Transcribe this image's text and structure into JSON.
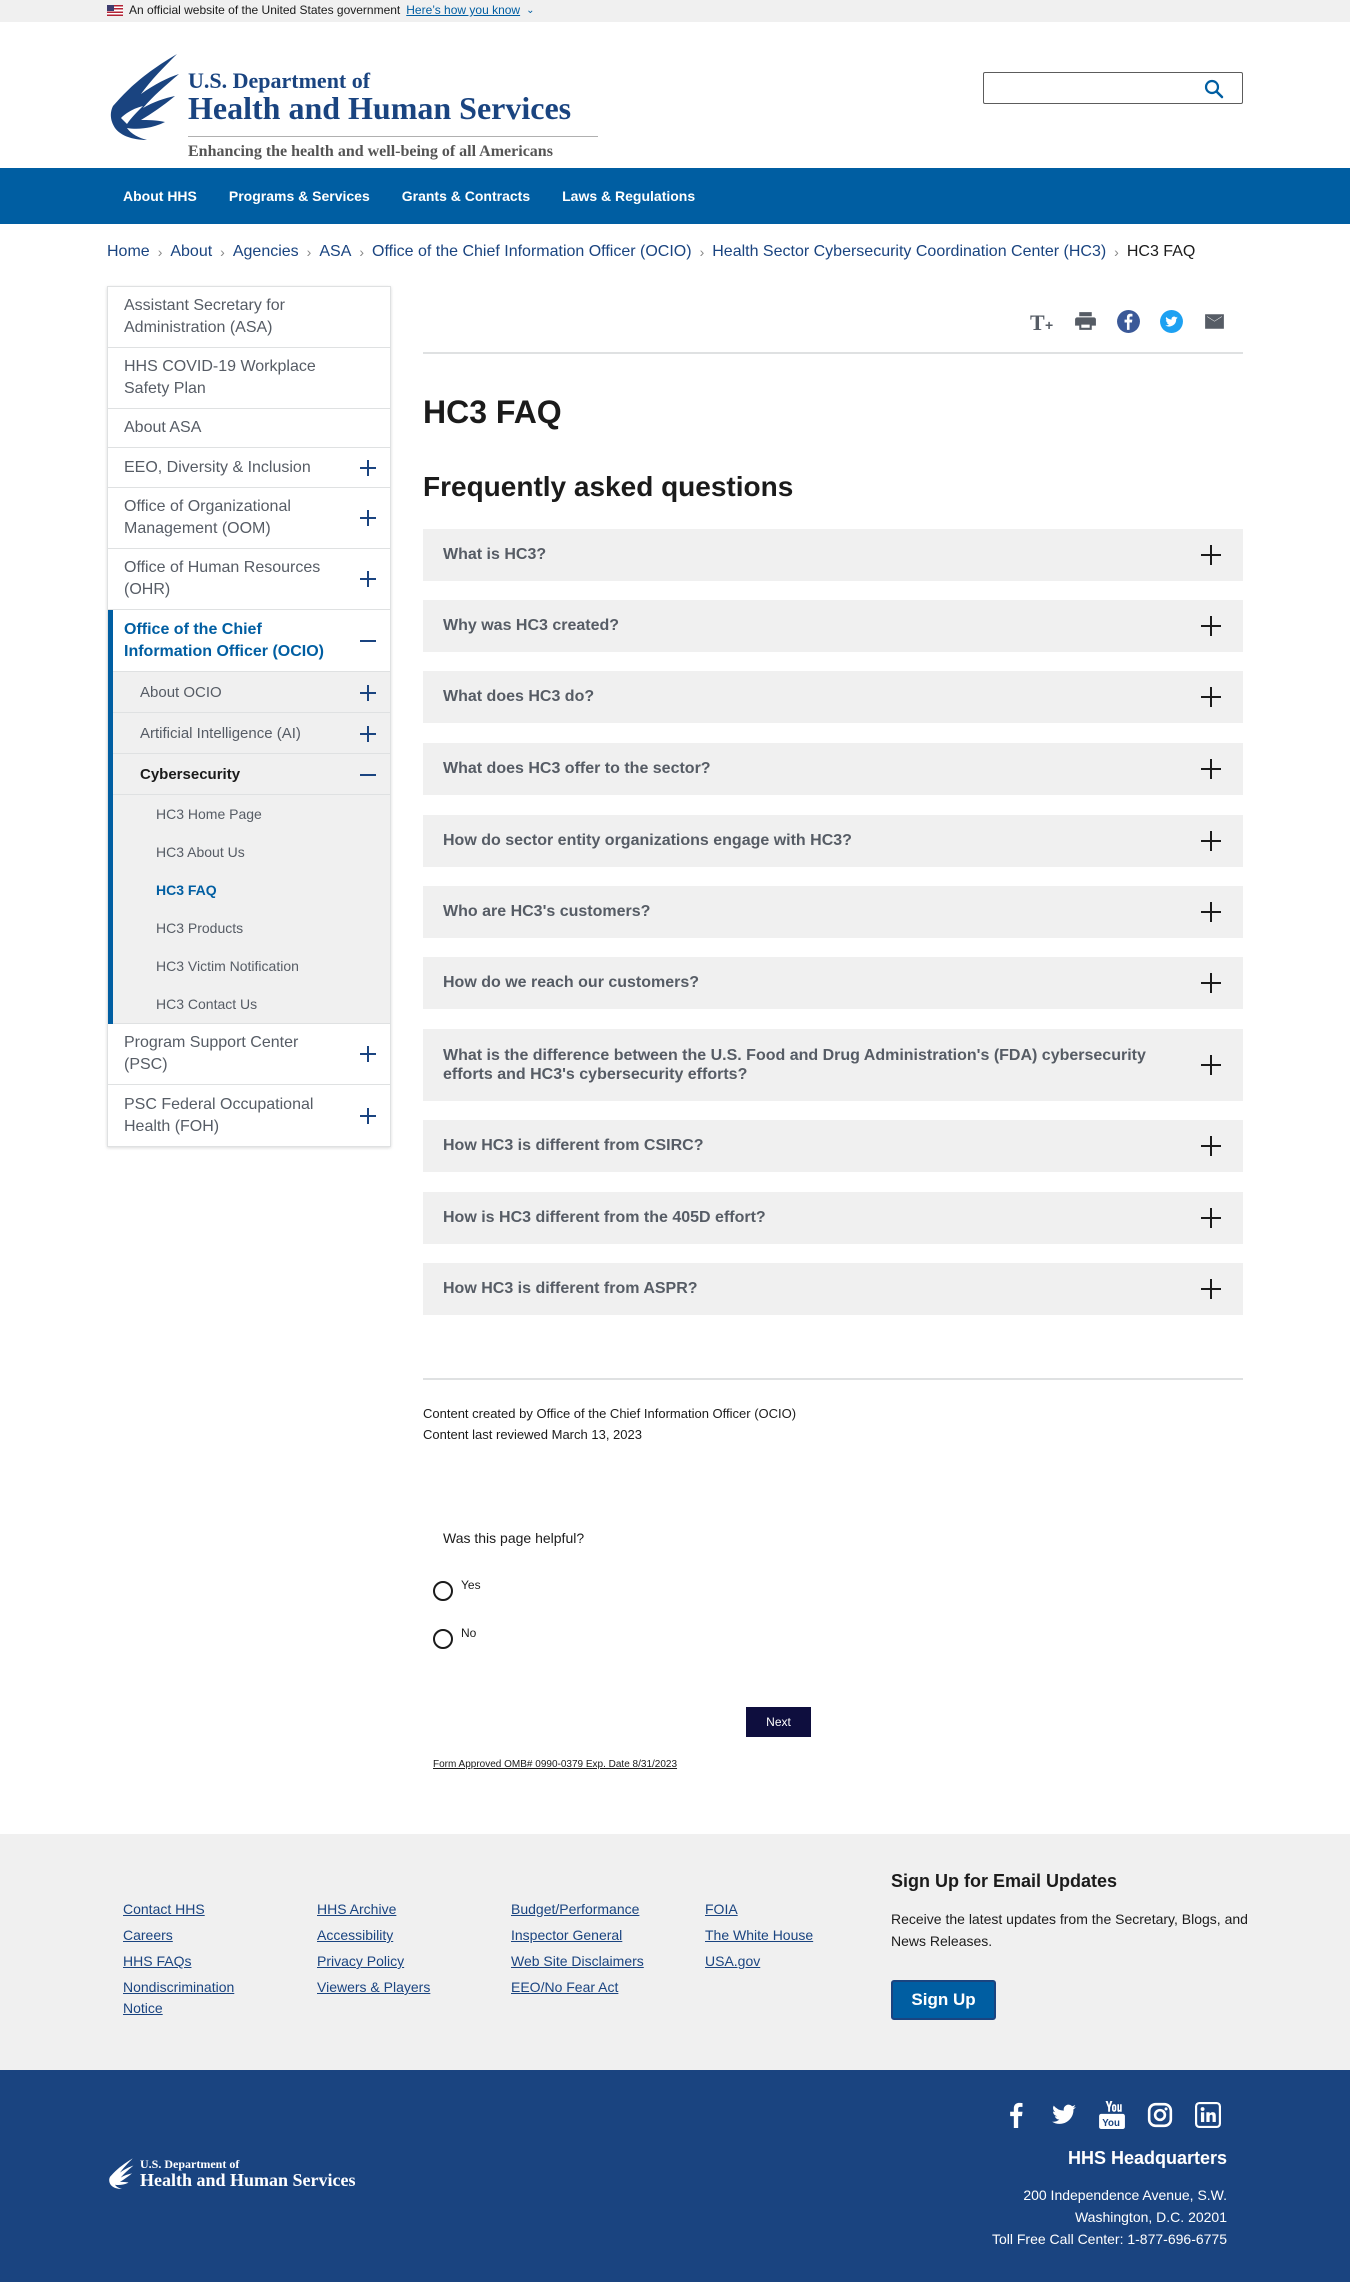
{
  "gov_banner": {
    "text": "An official website of the United States government",
    "link": "Here’s how you know"
  },
  "header": {
    "logo_line1": "U.S. Department of",
    "logo_line2": "Health and Human Services",
    "tagline": "Enhancing the health and well-being of all Americans",
    "search_placeholder": ""
  },
  "nav": {
    "items": [
      "About HHS",
      "Programs & Services",
      "Grants & Contracts",
      "Laws & Regulations"
    ]
  },
  "breadcrumb": {
    "items": [
      "Home",
      "About",
      "Agencies",
      "ASA",
      "Office of the Chief Information Officer (OCIO)",
      "Health Sector Cybersecurity Coordination Center (HC3)"
    ],
    "current": "HC3 FAQ"
  },
  "sidebar": {
    "items": [
      "Assistant Secretary for Administration (ASA)",
      "HHS COVID-19 Workplace Safety Plan",
      "About ASA",
      "EEO, Diversity & Inclusion",
      "Office of Organizational Management (OOM)",
      "Office of Human Resources (OHR)",
      "Office of the Chief Information Officer (OCIO)"
    ],
    "ocio_sub": [
      "About OCIO",
      "Artificial Intelligence (AI)",
      "Cybersecurity"
    ],
    "cyber_sub": [
      "HC3 Home Page",
      "HC3 About Us",
      "HC3 FAQ",
      "HC3 Products",
      "HC3 Victim Notification",
      "HC3 Contact Us"
    ],
    "tail": [
      "Program Support Center (PSC)",
      "PSC Federal Occupational Health (FOH)"
    ]
  },
  "tools": {
    "icons": [
      "text-size-icon",
      "print-icon",
      "facebook-icon",
      "twitter-icon",
      "email-icon"
    ]
  },
  "main": {
    "title": "HC3 FAQ",
    "faq_heading": "Frequently asked questions",
    "faqs": [
      "What is HC3?",
      "Why was HC3 created?",
      "What does HC3 do?",
      "What does HC3 offer to the sector?",
      "How do sector entity organizations engage with HC3?",
      "Who are HC3's customers?",
      "How do we reach our customers?",
      "What is the difference between the U.S. Food and Drug Administration's (FDA) cybersecurity efforts and HC3's cybersecurity efforts?",
      "How HC3 is different from CSIRC?",
      "How is HC3 different from the 405D effort?",
      "How HC3 is different from ASPR?"
    ],
    "content_created": "Content created by Office of the Chief Information Officer (OCIO)",
    "last_reviewed": "Content last reviewed March 13, 2023"
  },
  "survey": {
    "question": "Was this page helpful?",
    "yes": "Yes",
    "no": "No",
    "next": "Next",
    "omb": "Form Approved OMB# 0990-0379 Exp. Date 8/31/2023"
  },
  "footer": {
    "col1": [
      "Contact HHS",
      "Careers",
      "HHS FAQs",
      "Nondiscrimination Notice"
    ],
    "col2": [
      "HHS Archive",
      "Accessibility",
      "Privacy Policy",
      "Viewers & Players"
    ],
    "col3": [
      "Budget/Performance",
      "Inspector General",
      "Web Site Disclaimers",
      "EEO/No Fear Act"
    ],
    "col4": [
      "FOIA",
      "The White House",
      "USA.gov"
    ],
    "email_title": "Sign Up for Email Updates",
    "email_text": "Receive the latest updates from the Secretary, Blogs, and News Releases.",
    "signup": "Sign Up"
  },
  "bottom": {
    "logo_line1": "U.S. Department of",
    "logo_line2": "Health and Human Services",
    "social_icons": [
      "facebook-icon",
      "twitter-icon",
      "youtube-icon",
      "instagram-icon",
      "linkedin-icon"
    ],
    "hq_title": "HHS Headquarters",
    "address1": "200 Independence Avenue, S.W.",
    "address2": "Washington, D.C. 20201",
    "tollfree": "Toll Free Call Center: 1-877-696-6775"
  },
  "colors": {
    "primary": "#005ea2",
    "dark_blue": "#1a4480",
    "survey_button": "#0e0e3e"
  }
}
